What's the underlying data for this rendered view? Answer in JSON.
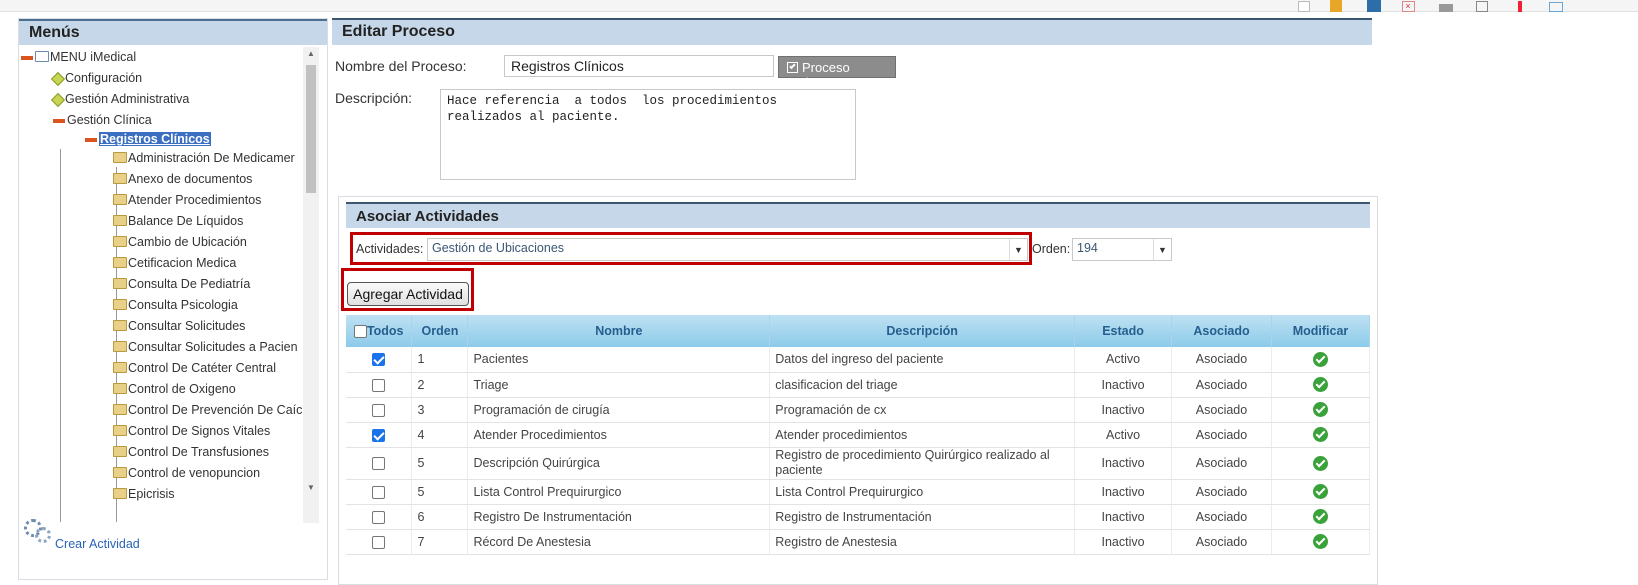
{
  "left": {
    "title": "Menús",
    "root": "MENU iMedical",
    "level1": [
      "Configuración",
      "Gestión Administrativa",
      "Gestión Clínica"
    ],
    "selected": "Registros Clínicos",
    "children": [
      "Administración De Medicamer",
      "Anexo de documentos",
      "Atender Procedimientos",
      "Balance De Líquidos",
      "Cambio de Ubicación",
      "Cetificacion Medica",
      "Consulta De Pediatría",
      "Consulta Psicologia",
      "Consultar Solicitudes",
      "Consultar Solicitudes a Pacien",
      "Control De Catéter Central",
      "Control de Oxigeno",
      "Control De Prevención De Caíc",
      "Control De Signos Vitales",
      "Control De Transfusiones",
      "Control de venopuncion",
      "Epicrisis"
    ],
    "create_link": "Crear Actividad"
  },
  "edit": {
    "title": "Editar Proceso",
    "name_label": "Nombre del Proceso:",
    "name_value": "Registros Clínicos",
    "active_button": "Proceso Activo",
    "desc_label": "Descripción:",
    "desc_value": "Hace referencia  a todos  los procedimientos\nrealizados al paciente."
  },
  "assoc": {
    "title": "Asociar Actividades",
    "activities_label": "Actividades:",
    "activities_value": "Gestión de Ubicaciones",
    "order_label": "Orden:",
    "order_value": "194",
    "add_button": "Agregar Actividad"
  },
  "table": {
    "headers": {
      "all": "Todos",
      "order": "Orden",
      "name": "Nombre",
      "description": "Descripción",
      "state": "Estado",
      "associated": "Asociado",
      "modify": "Modificar"
    },
    "rows": [
      {
        "checked": true,
        "order": "1",
        "name": "Pacientes",
        "description": "Datos del ingreso del paciente",
        "state": "Activo",
        "associated": "Asociado"
      },
      {
        "checked": false,
        "order": "2",
        "name": "Triage",
        "description": "clasificacion del triage",
        "state": "Inactivo",
        "associated": "Asociado"
      },
      {
        "checked": false,
        "order": "3",
        "name": "Programación de cirugía",
        "description": "Programación de cx",
        "state": "Inactivo",
        "associated": "Asociado"
      },
      {
        "checked": true,
        "order": "4",
        "name": "Atender Procedimientos",
        "description": "Atender procedimientos",
        "state": "Activo",
        "associated": "Asociado"
      },
      {
        "checked": false,
        "order": "5",
        "name": "Descripción Quirúrgica",
        "description": "Registro de procedimiento Quirúrgico realizado al paciente",
        "state": "Inactivo",
        "associated": "Asociado"
      },
      {
        "checked": false,
        "order": "5",
        "name": "Lista Control Prequirurgico",
        "description": "Lista Control Prequirurgico",
        "state": "Inactivo",
        "associated": "Asociado"
      },
      {
        "checked": false,
        "order": "6",
        "name": "Registro De Instrumentación",
        "description": "Registro de Instrumentación",
        "state": "Inactivo",
        "associated": "Asociado"
      },
      {
        "checked": false,
        "order": "7",
        "name": "Récord De Anestesia",
        "description": "Registro de Anestesia",
        "state": "Inactivo",
        "associated": "Asociado"
      }
    ]
  },
  "colors": {
    "header_bg": "#c5d7e8",
    "highlight_red": "#c00000",
    "table_header": "#8ccbea",
    "ok_green": "#3aa23a"
  },
  "toolbar_icons": [
    "new-document-icon",
    "bookmark-icon",
    "save-icon",
    "delete-icon",
    "print-icon",
    "search-icon",
    "alert-icon",
    "chat-icon"
  ]
}
